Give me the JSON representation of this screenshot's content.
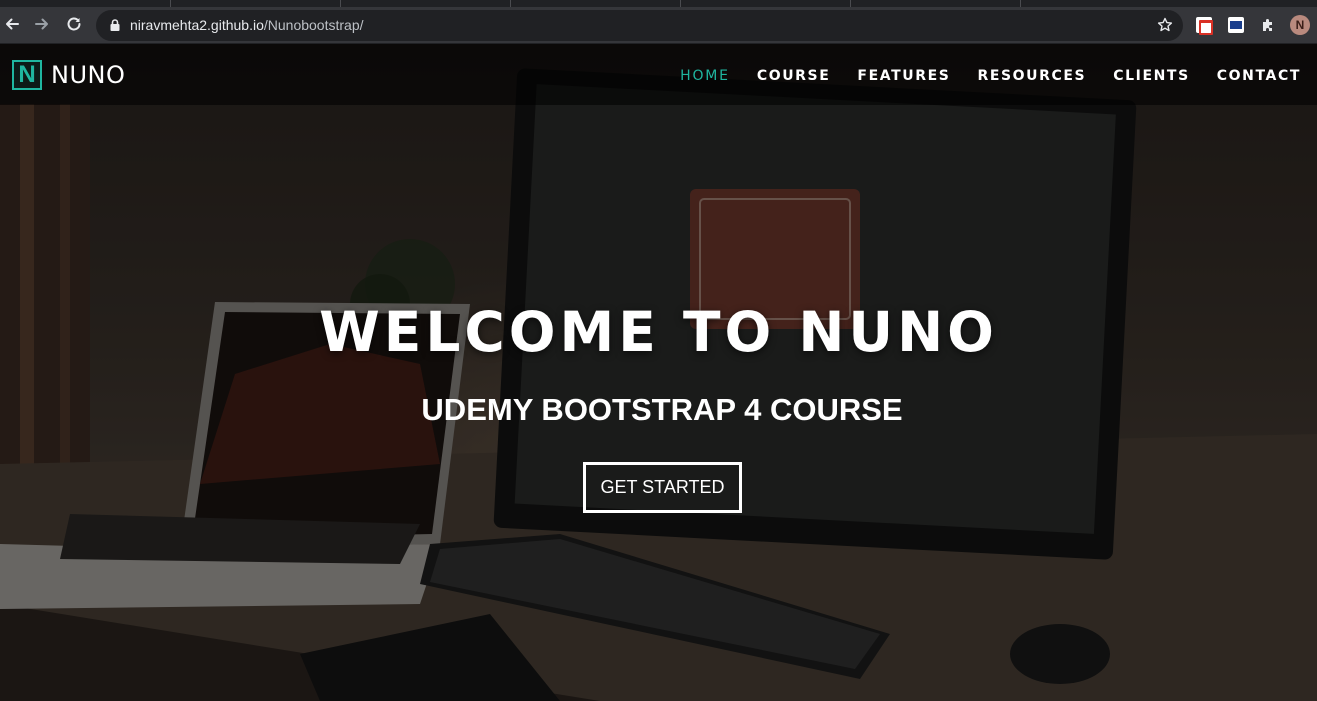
{
  "browser": {
    "url_host": "niravmehta2.github.io",
    "url_path": "/Nunobootstrap/",
    "profile_initial": "N"
  },
  "site": {
    "brand_letter": "N",
    "brand_name": "NUNO",
    "accent_color": "#1fb6a0",
    "nav": [
      {
        "label": "HOME",
        "active": true
      },
      {
        "label": "COURSE",
        "active": false
      },
      {
        "label": "FEATURES",
        "active": false
      },
      {
        "label": "RESOURCES",
        "active": false
      },
      {
        "label": "CLIENTS",
        "active": false
      },
      {
        "label": "CONTACT",
        "active": false
      }
    ],
    "hero": {
      "title": "WELCOME TO NUNO",
      "subtitle": "UDEMY BOOTSTRAP 4 COURSE",
      "button": "GET STARTED"
    }
  }
}
